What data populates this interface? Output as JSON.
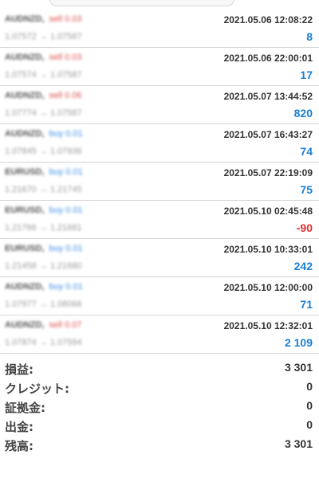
{
  "trades": [
    {
      "symbol": "AUDNZD,",
      "direction": "sell 0.03",
      "side": "sell",
      "prices": "1.07572 → 1.07587",
      "time": "2021.05.06 12:08:22",
      "profit": "8",
      "negative": false
    },
    {
      "symbol": "AUDNZD,",
      "direction": "sell 0.03",
      "side": "sell",
      "prices": "1.07574 → 1.07587",
      "time": "2021.05.06 22:00:01",
      "profit": "17",
      "negative": false
    },
    {
      "symbol": "AUDNZD,",
      "direction": "sell 0.06",
      "side": "sell",
      "prices": "1.07774 → 1.07587",
      "time": "2021.05.07 13:44:52",
      "profit": "820",
      "negative": false
    },
    {
      "symbol": "AUDNZD,",
      "direction": "buy 0.01",
      "side": "buy",
      "prices": "1.07845 → 1.07936",
      "time": "2021.05.07 16:43:27",
      "profit": "74",
      "negative": false
    },
    {
      "symbol": "EURUSD,",
      "direction": "buy 0.01",
      "side": "buy",
      "prices": "1.21670 → 1.21745",
      "time": "2021.05.07 22:19:09",
      "profit": "75",
      "negative": false
    },
    {
      "symbol": "EURUSD,",
      "direction": "buy 0.01",
      "side": "buy",
      "prices": "1.21766 → 1.21681",
      "time": "2021.05.10 02:45:48",
      "profit": "-90",
      "negative": true
    },
    {
      "symbol": "EURUSD,",
      "direction": "buy 0.01",
      "side": "buy",
      "prices": "1.21458 → 1.21680",
      "time": "2021.05.10 10:33:01",
      "profit": "242",
      "negative": false
    },
    {
      "symbol": "AUDNZD,",
      "direction": "buy 0.01",
      "side": "buy",
      "prices": "1.07977 → 1.08066",
      "time": "2021.05.10 12:00:00",
      "profit": "71",
      "negative": false
    },
    {
      "symbol": "AUDNZD,",
      "direction": "sell 0.07",
      "side": "sell",
      "prices": "1.07874 → 1.07594",
      "time": "2021.05.10 12:32:01",
      "profit": "2 109",
      "negative": false
    }
  ],
  "summary": [
    {
      "label": "損益:",
      "value": "3 301"
    },
    {
      "label": "クレジット:",
      "value": "0"
    },
    {
      "label": "証拠金:",
      "value": "0"
    },
    {
      "label": "出金:",
      "value": "0"
    },
    {
      "label": "残高:",
      "value": "3 301"
    }
  ],
  "colors": {
    "profit_positive": "#1a7fd4",
    "profit_negative": "#e03030",
    "sell": "#e05050",
    "buy": "#3d8ee6"
  }
}
